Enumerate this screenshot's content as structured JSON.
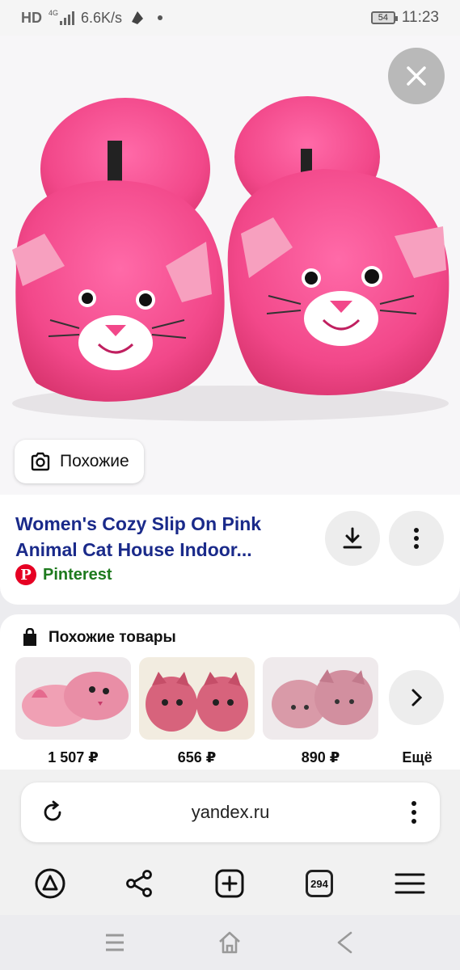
{
  "status_bar": {
    "network_type": "HD",
    "network_gen": "4G",
    "speed": "6.6K/s",
    "battery_level": "54",
    "time": "11:23"
  },
  "image_viewer": {
    "close_icon": "close-icon",
    "similar_button_label": "Похожие"
  },
  "result": {
    "title": "Women's Cozy Slip On Pink Animal Cat House Indoor...",
    "source_name": "Pinterest",
    "source_logo_letter": "P"
  },
  "similar_products": {
    "heading": "Похожие товары",
    "items": [
      {
        "price": "1 507 ₽"
      },
      {
        "price": "656 ₽"
      },
      {
        "price": "890 ₽"
      }
    ],
    "more_label": "Ещё"
  },
  "browser": {
    "url": "yandex.ru",
    "tabs_count": "294"
  },
  "colors": {
    "title_blue": "#1a2a8a",
    "source_green": "#1e7a1e",
    "slipper_pink": "#f2488a"
  }
}
